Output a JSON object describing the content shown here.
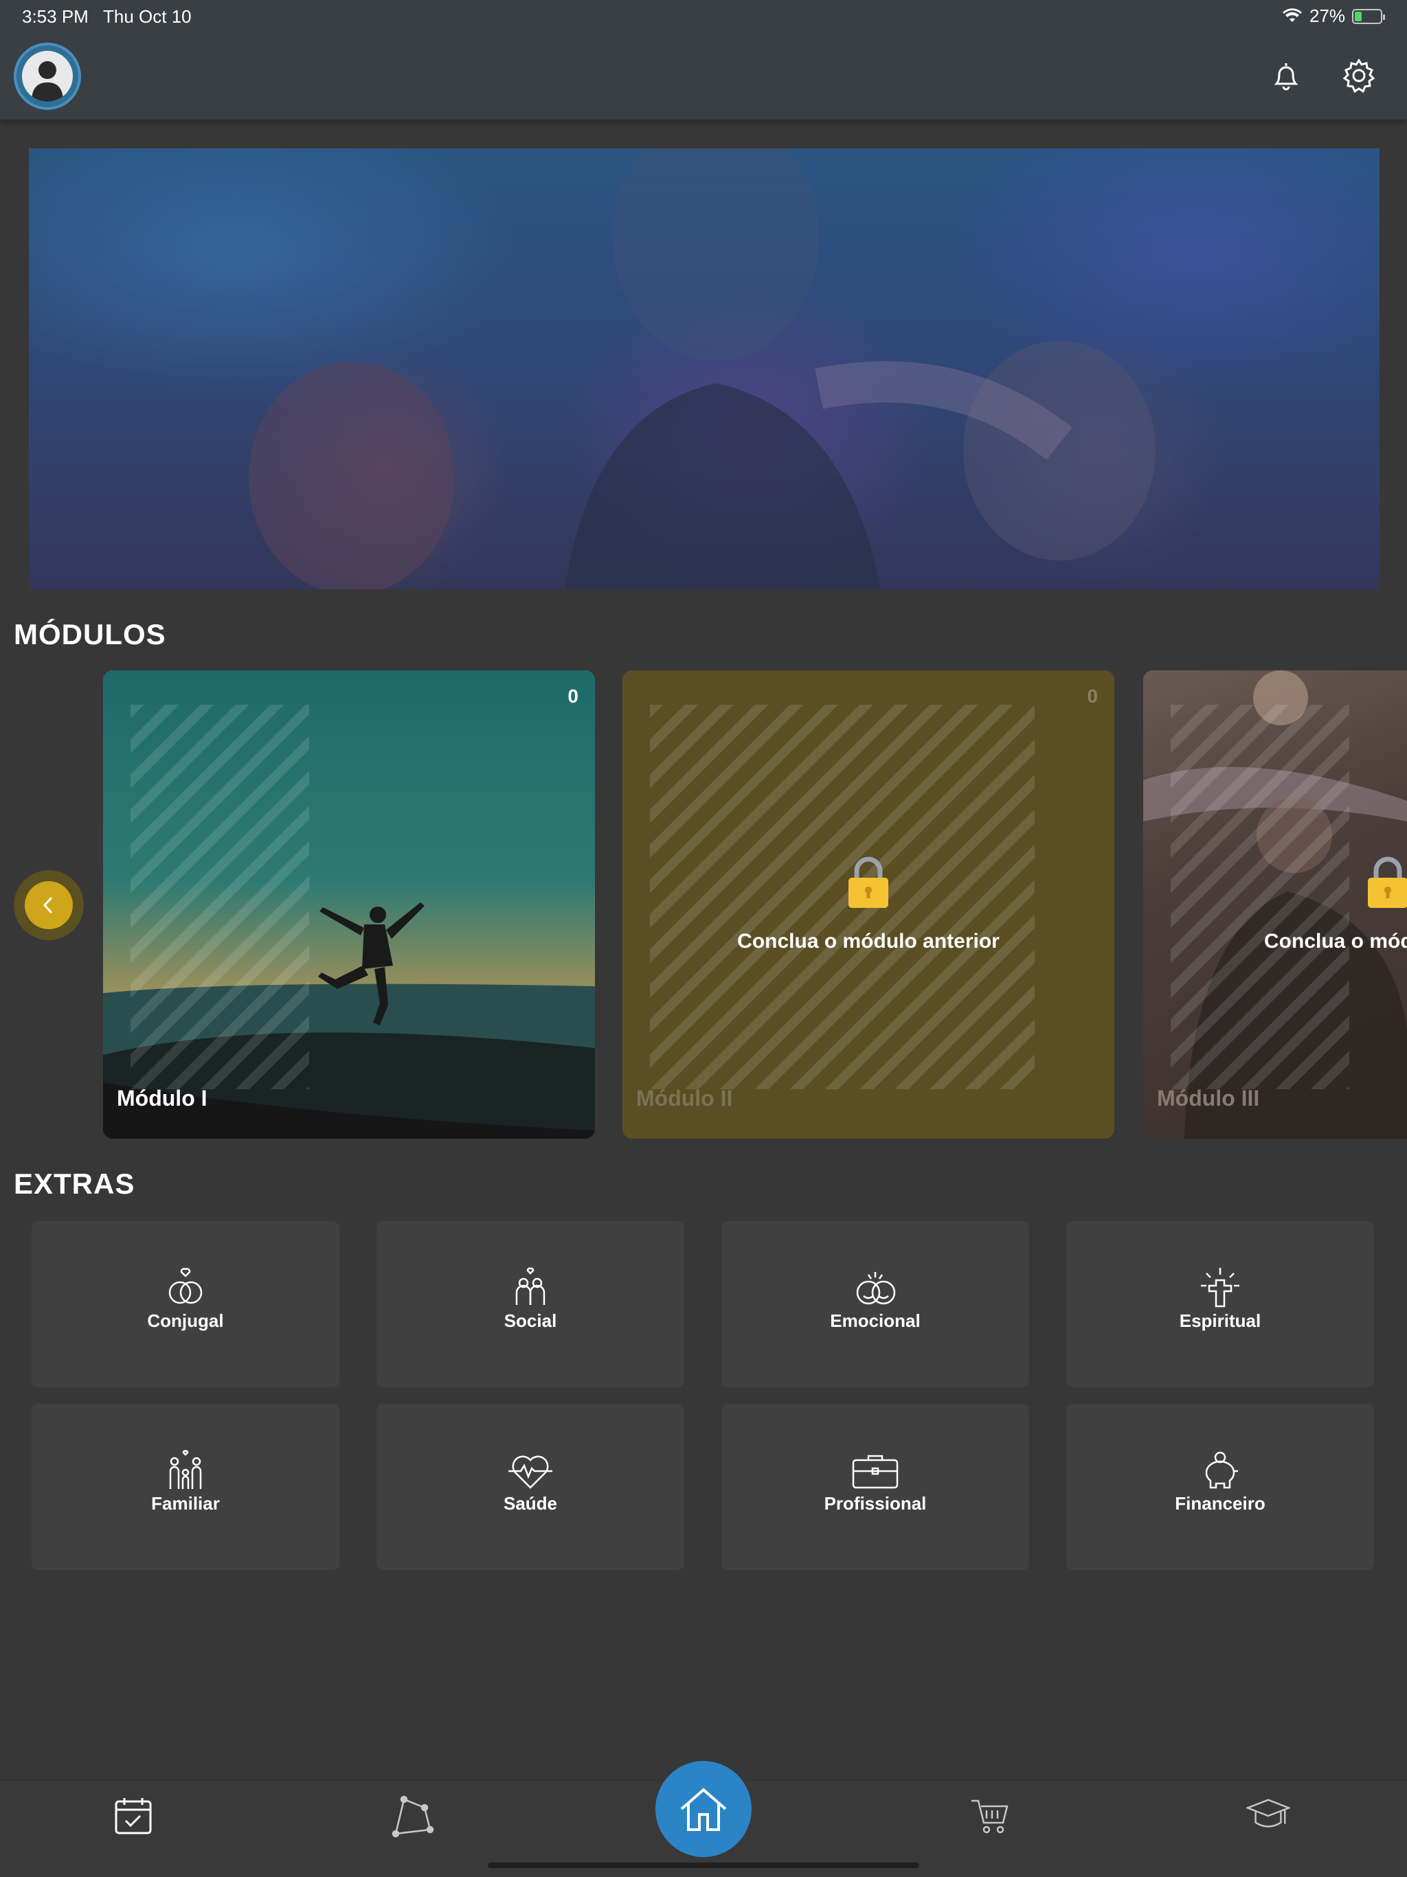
{
  "status_bar": {
    "time": "3:53 PM",
    "date": "Thu Oct 10",
    "battery": "27%",
    "battery_level": 0.27
  },
  "header": {
    "avatar_icon": "user-avatar-icon",
    "notifications_icon": "bell-icon",
    "settings_icon": "gear-icon"
  },
  "banner": {
    "image": "blurred-crowd-photo"
  },
  "modules": {
    "title": "MÓDULOS",
    "prev_icon": "chevron-left-icon",
    "cards": [
      {
        "title": "Módulo I",
        "count": "0",
        "locked": false
      },
      {
        "title": "Módulo II",
        "count": "0",
        "locked": true,
        "message": "Conclua o módulo anterior"
      },
      {
        "title": "Módulo III",
        "count": "",
        "locked": true,
        "message": "Conclua o módulo anterior"
      }
    ]
  },
  "extras": {
    "title": "EXTRAS",
    "items": [
      {
        "label": "Conjugal",
        "icon": "rings-icon"
      },
      {
        "label": "Social",
        "icon": "people-icon"
      },
      {
        "label": "Emocional",
        "icon": "faces-icon"
      },
      {
        "label": "Espiritual",
        "icon": "cross-icon"
      },
      {
        "label": "Familiar",
        "icon": "family-icon"
      },
      {
        "label": "Saúde",
        "icon": "heart-pulse-icon"
      },
      {
        "label": "Profissional",
        "icon": "briefcase-icon"
      },
      {
        "label": "Financeiro",
        "icon": "piggy-bank-icon"
      }
    ]
  },
  "tabbar": {
    "items": [
      "calendar-icon",
      "network-icon",
      "home-icon",
      "cart-icon",
      "graduation-cap-icon"
    ]
  },
  "colors": {
    "background": "#373737",
    "header": "#3a3f44",
    "accent_blue": "#2b84c6",
    "accent_gold": "#cfa51a",
    "tile": "#404040"
  }
}
